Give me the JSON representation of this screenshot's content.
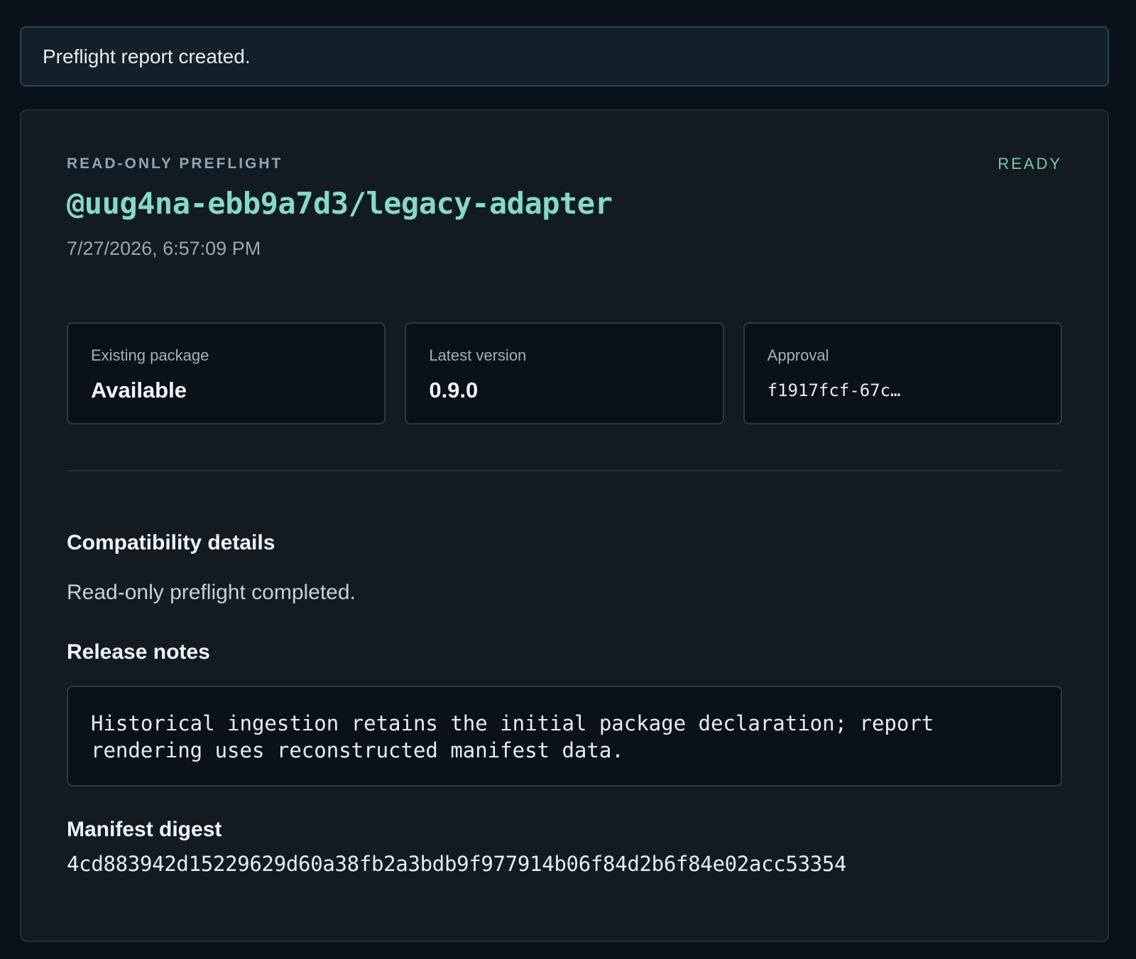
{
  "notice": {
    "text": "Preflight report created."
  },
  "report": {
    "eyebrow": "READ-ONLY PREFLIGHT",
    "status": "READY",
    "package_name": "@uug4na-ebb9a7d3/legacy-adapter",
    "timestamp": "7/27/2026, 6:57:09 PM",
    "stats": [
      {
        "label": "Existing package",
        "value": "Available"
      },
      {
        "label": "Latest version",
        "value": "0.9.0"
      },
      {
        "label": "Approval",
        "value": "f1917fcf-67c…"
      }
    ],
    "compatibility": {
      "title": "Compatibility details",
      "text": "Read-only preflight completed."
    },
    "release_notes": {
      "title": "Release notes",
      "text": "Historical ingestion retains the initial package declaration; report rendering uses reconstructed manifest data."
    },
    "manifest_digest": {
      "title": "Manifest digest",
      "value": "4cd883942d15229629d60a38fb2a3bdb9f977914b06f84d2b6f84e02acc53354"
    }
  },
  "colors": {
    "background": "#0b1118",
    "card": "#121a22",
    "accent": "#86d9c9",
    "status": "#7cc9a5"
  }
}
